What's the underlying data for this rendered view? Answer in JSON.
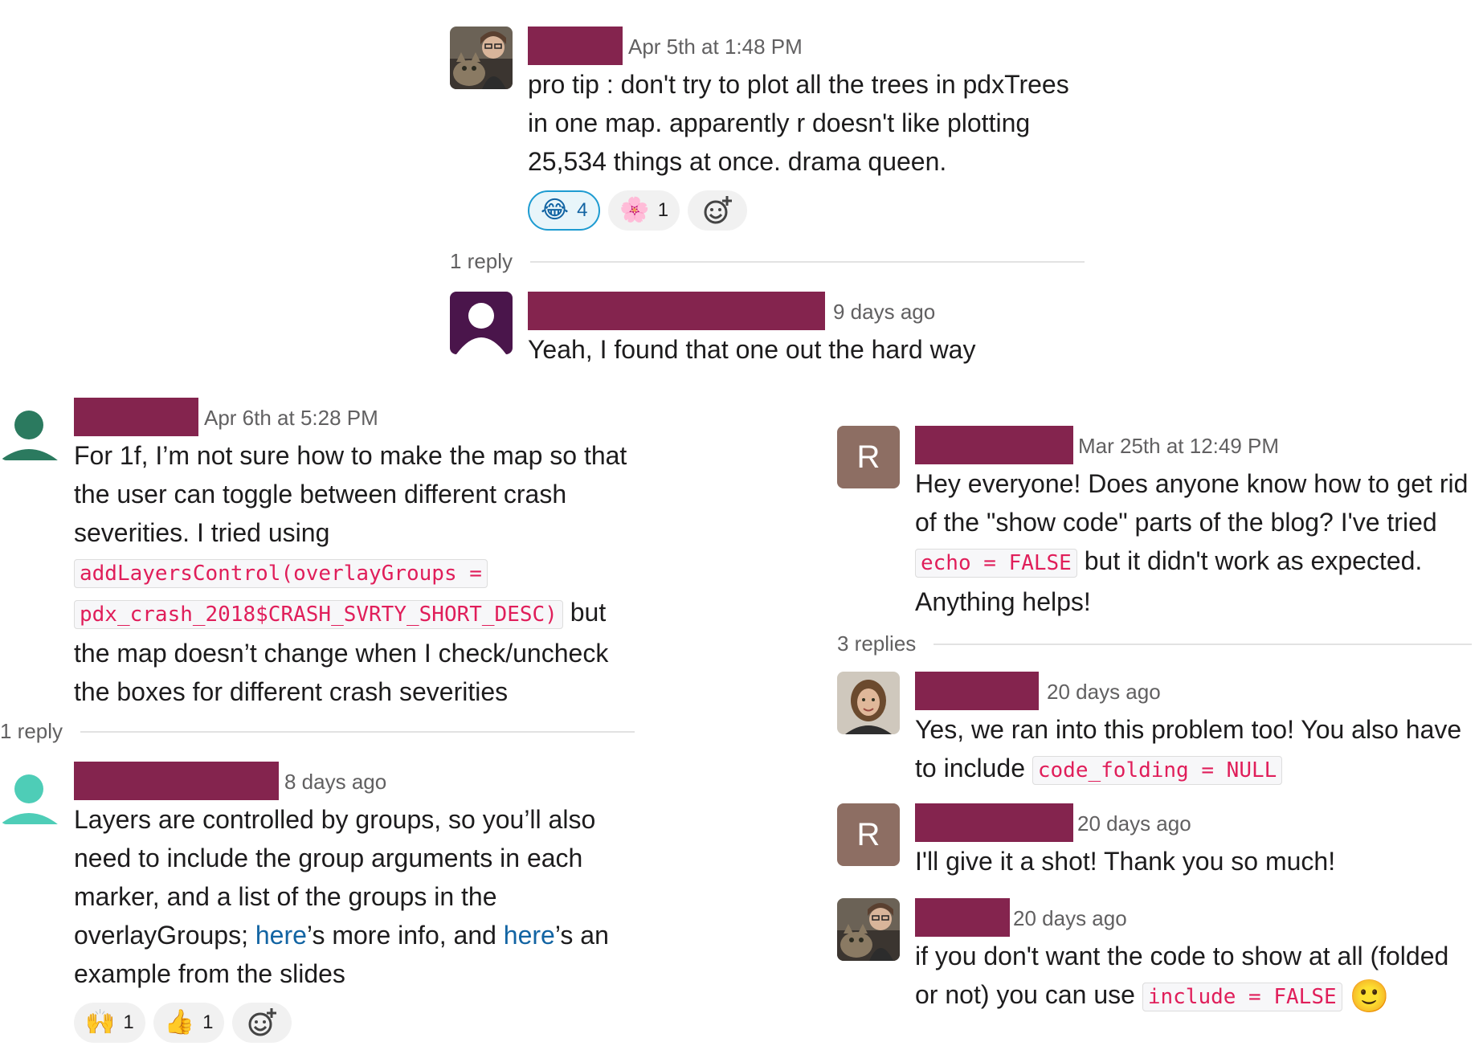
{
  "thread1": {
    "parent": {
      "timestamp": "Apr 5th at 1:48 PM",
      "lines": [
        "pro tip : don't try to plot all the trees in pdxTrees",
        "in one map. apparently r doesn't like plotting",
        "25,534 things at once. drama queen."
      ],
      "reactions": [
        {
          "emoji": "😂",
          "count": "4"
        },
        {
          "emoji": "🌸",
          "count": "1"
        }
      ]
    },
    "reply_count": "1 reply",
    "reply": {
      "timestamp": "9 days ago",
      "text": "Yeah, I found that one out the hard way"
    }
  },
  "thread2": {
    "parent": {
      "timestamp": "Apr 6th at 5:28 PM",
      "line1": "For 1f, I’m not sure how to make the map so that",
      "line2": "the user can toggle between different crash",
      "line3": "severities. I tried using",
      "code1": "addLayersControl(overlayGroups =",
      "code2": "pdx_crash_2018$CRASH_SVRTY_SHORT_DESC)",
      "after_code": "but",
      "line6": "the map doesn’t change when I check/uncheck",
      "line7": "the boxes for different crash severities"
    },
    "reply_count": "1 reply",
    "reply": {
      "timestamp": "8 days ago",
      "line1": "Layers are controlled by groups, so you’ll also",
      "line2": "need to include the group arguments in each",
      "line3": "marker, and a list of the groups in the",
      "line4_a": "overlayGroups; ",
      "link1": "here",
      "line4_b": "’s more info, and ",
      "link2": "here",
      "line4_c": "’s an",
      "line5": "example from the slides",
      "reactions": [
        {
          "emoji": "🙌",
          "count": "1"
        },
        {
          "emoji": "👍",
          "count": "1"
        }
      ]
    }
  },
  "thread3": {
    "parent": {
      "avatar_letter": "R",
      "timestamp": "Mar 25th at 12:49 PM",
      "line1": "Hey everyone! Does anyone know how to get rid",
      "line2": "of the \"show code\" parts of the blog? I've tried",
      "code": "echo = FALSE",
      "line3_rest": "but it didn't work as expected.",
      "line4": "Anything helps!"
    },
    "reply_count": "3 replies",
    "reply1": {
      "timestamp": "20 days ago",
      "line1": "Yes, we ran into this problem too! You also have",
      "line2_a": "to include",
      "code": "code_folding = NULL"
    },
    "reply2": {
      "avatar_letter": "R",
      "timestamp": "20 days ago",
      "text": "I'll give it a shot! Thank you so much!"
    },
    "reply3": {
      "timestamp": "20 days ago",
      "line1": "if you don't want the code to show at all (folded",
      "line2_a": "or not) you can use",
      "code": "include = FALSE",
      "emoji": "🙂"
    }
  },
  "colors": {
    "redaction": "#84244e",
    "link": "#1264a3",
    "code_text": "#e01e5a",
    "timestamp": "#616061",
    "avatar_green": "#2b7a5f",
    "avatar_teal": "#4ecdb7",
    "avatar_purple": "#4a154b",
    "avatar_brown": "#8d6e63"
  },
  "icons": {
    "add_reaction": "add-reaction-icon",
    "photo_avatar": "cat-photo-avatar",
    "default_avatar": "person-silhouette"
  }
}
